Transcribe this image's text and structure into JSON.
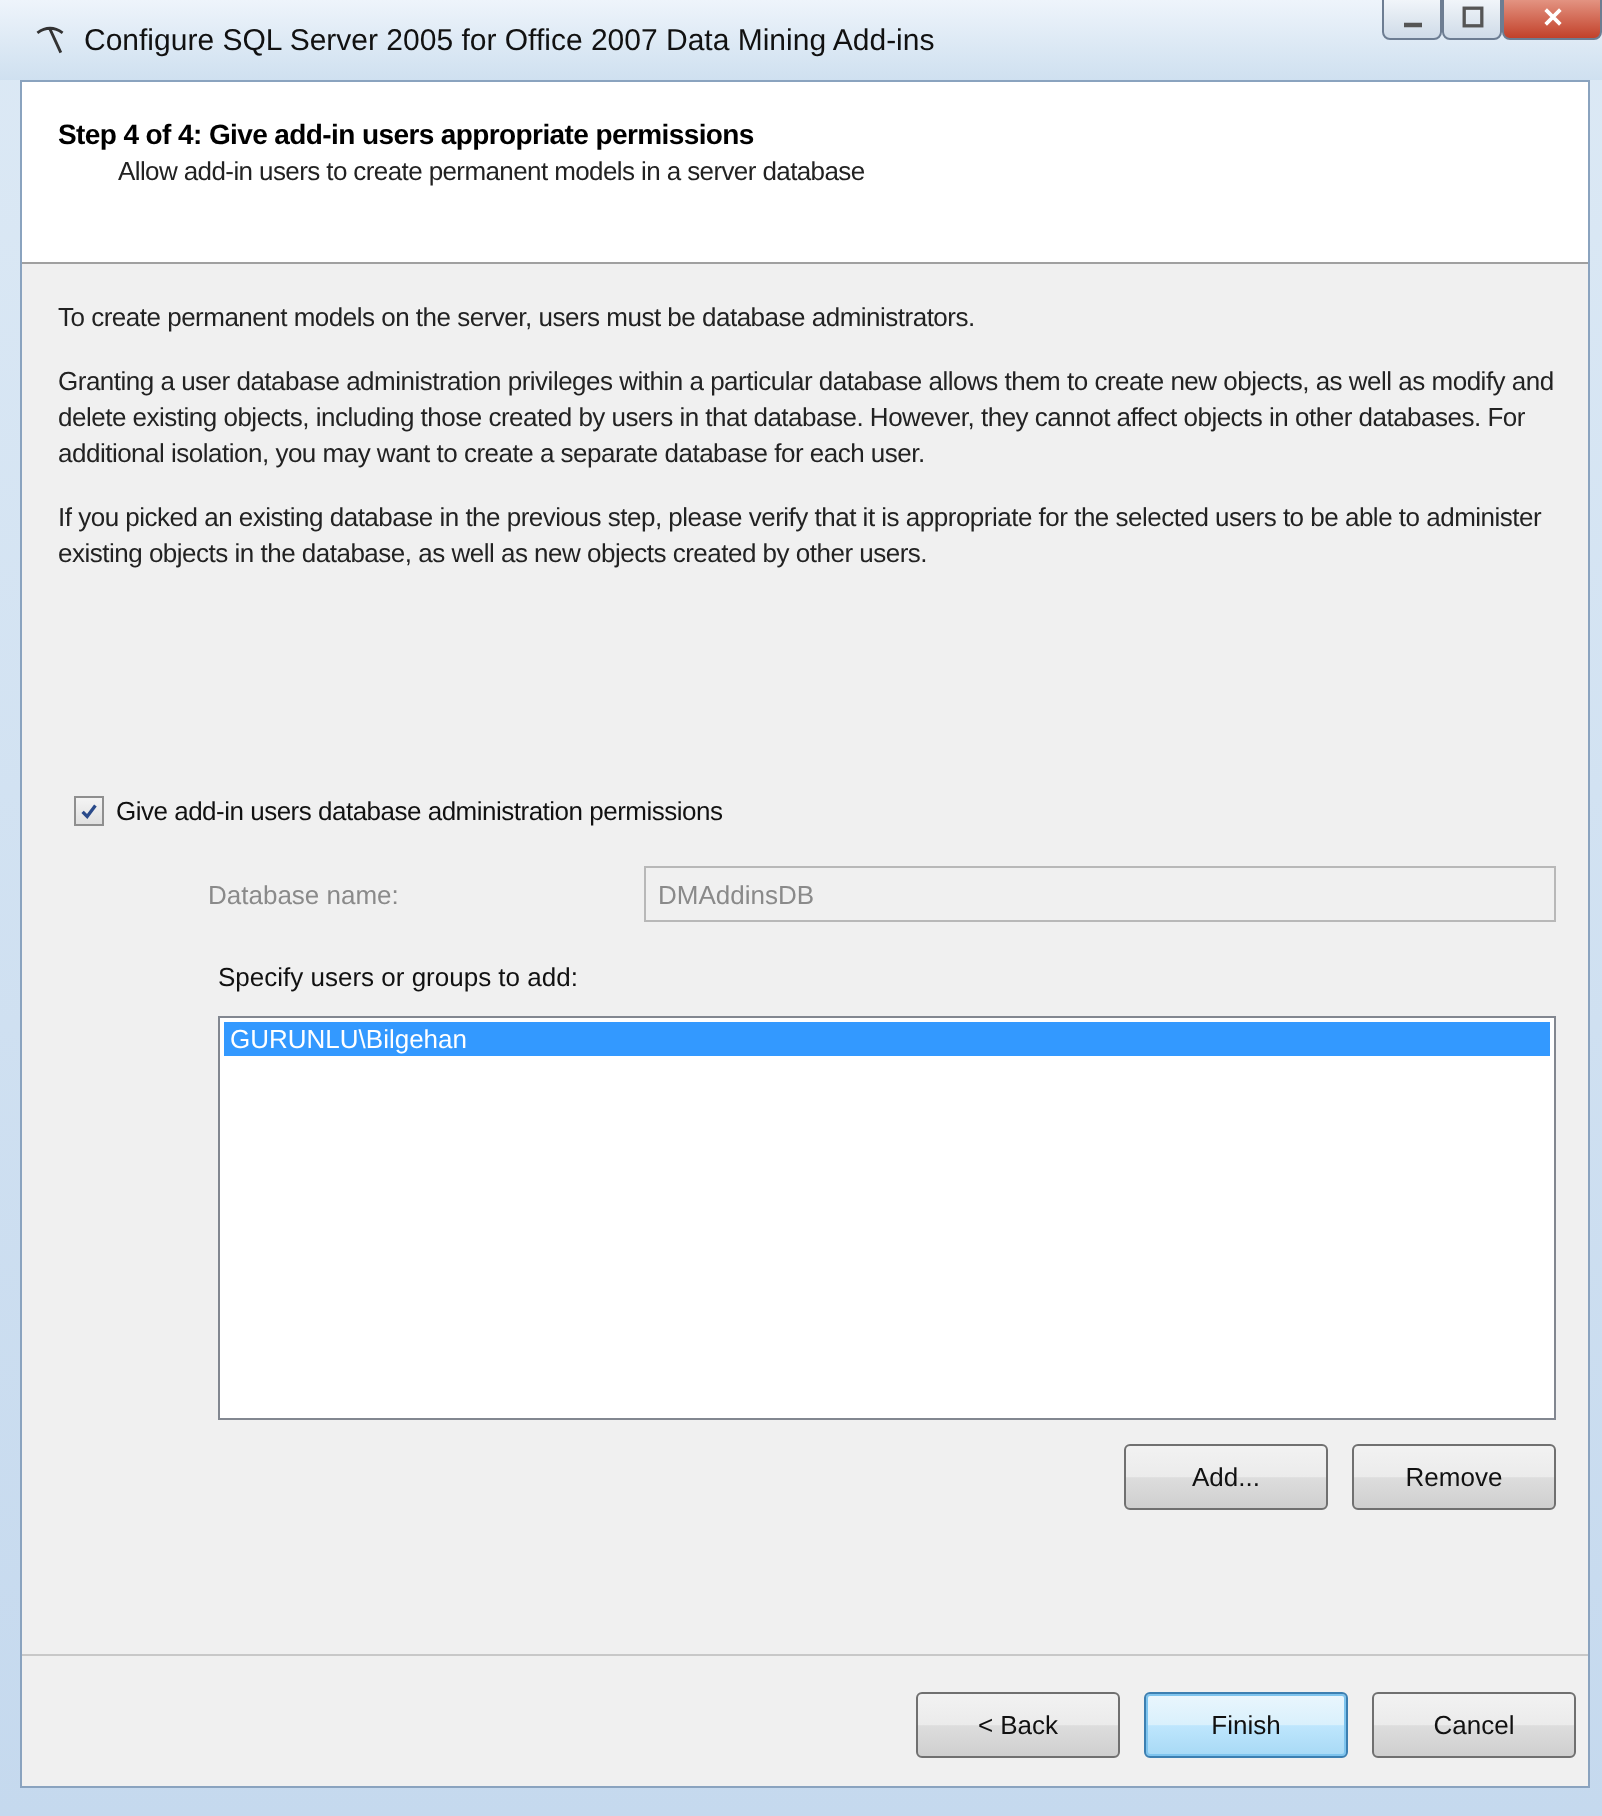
{
  "window": {
    "title": "Configure SQL Server 2005 for Office 2007 Data Mining Add-ins"
  },
  "header": {
    "title": "Step 4 of 4: Give add-in users appropriate permissions",
    "subtitle": "Allow add-in users to create permanent models in a server database"
  },
  "paragraphs": [
    "To create permanent models on the server, users must be database administrators.",
    "Granting a user database administration privileges within a particular database allows them to create new objects, as well as modify and delete existing objects, including those created by users in that database. However, they cannot affect objects in other databases. For additional isolation, you may want to create a separate database for each user.",
    "If you picked an existing database in the previous step, please verify that it is appropriate for the selected users to be able to administer existing objects in the database, as well as new objects created by other users."
  ],
  "permission_checkbox": {
    "label": "Give add-in users database administration permissions",
    "checked": true
  },
  "database_name": {
    "label": "Database name:",
    "value": "DMAddinsDB",
    "disabled": true
  },
  "users_list": {
    "label": "Specify users or groups to add:",
    "items": [
      {
        "text": "GURUNLU\\Bilgehan",
        "selected": true
      }
    ]
  },
  "list_buttons": [
    {
      "label": "Add...",
      "default": false
    },
    {
      "label": "Remove",
      "default": false
    }
  ],
  "footer_buttons": [
    {
      "label": "< Back",
      "default": false
    },
    {
      "label": "Finish",
      "default": true
    },
    {
      "label": "Cancel",
      "default": false
    }
  ]
}
